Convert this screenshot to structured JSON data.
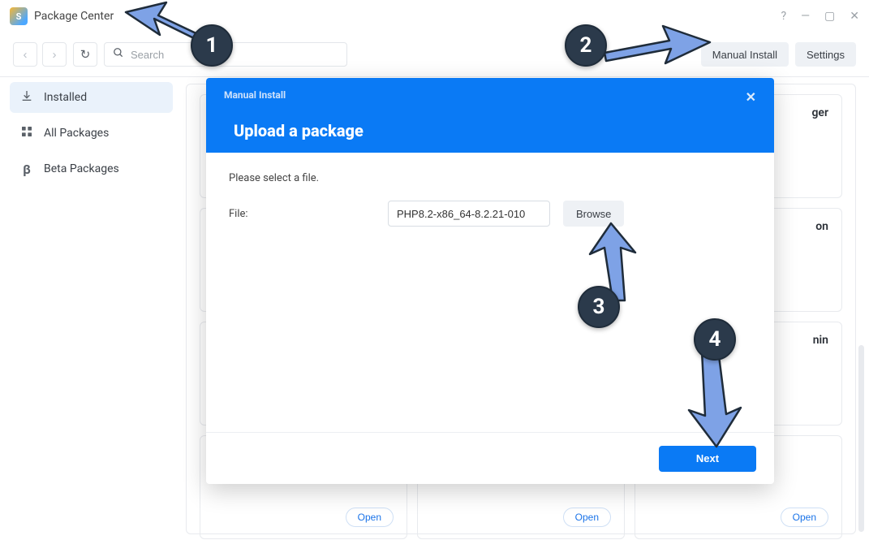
{
  "window": {
    "title": "Package Center",
    "app_icon_letter": "S"
  },
  "toolbar": {
    "search_placeholder": "Search",
    "manual_install_label": "Manual Install",
    "settings_label": "Settings"
  },
  "sidebar": {
    "items": [
      {
        "label": "Installed",
        "icon": "download-icon",
        "active": true
      },
      {
        "label": "All Packages",
        "icon": "grid-icon",
        "active": false
      },
      {
        "label": "Beta Packages",
        "icon": "beta-icon",
        "active": false
      }
    ]
  },
  "packages": {
    "partial_labels": [
      "ger",
      "on",
      "nin"
    ],
    "open_label": "Open"
  },
  "modal": {
    "title": "Manual Install",
    "heading": "Upload a package",
    "hint": "Please select a file.",
    "file_label": "File:",
    "file_value": "PHP8.2-x86_64-8.2.21-010",
    "browse_label": "Browse",
    "next_label": "Next"
  },
  "annotations": {
    "badge1": "1",
    "badge2": "2",
    "badge3": "3",
    "badge4": "4"
  },
  "colors": {
    "accent": "#0a7af5",
    "badge_bg": "#2b3a4b",
    "arrow_fill": "#7ea2e6",
    "arrow_stroke": "#1f2c3a"
  }
}
